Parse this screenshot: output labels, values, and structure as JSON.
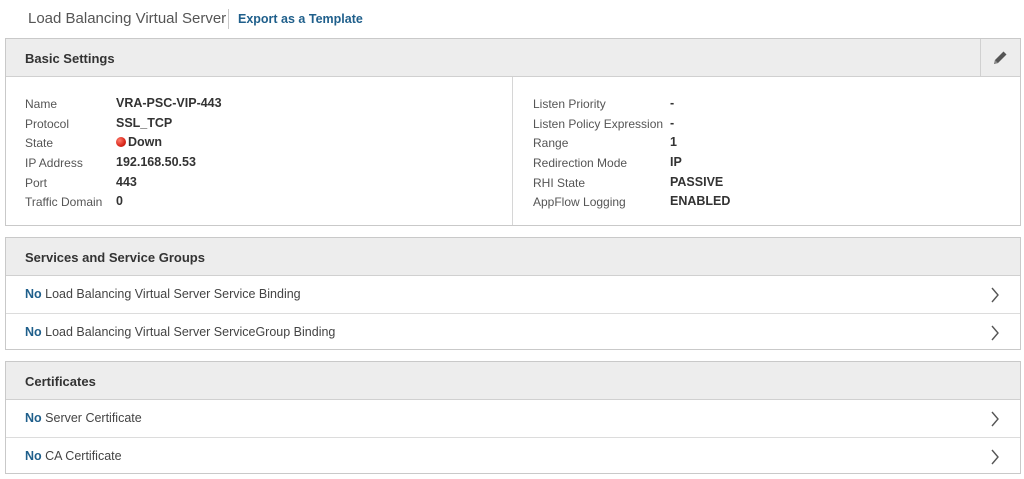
{
  "header": {
    "title": "Load Balancing Virtual Server",
    "export_link": "Export as a Template"
  },
  "basic_settings": {
    "title": "Basic Settings",
    "edit_icon": "pencil-icon",
    "left": [
      {
        "key": "Name",
        "value": "VRA-PSC-VIP-443"
      },
      {
        "key": "Protocol",
        "value": "SSL_TCP"
      },
      {
        "key": "State",
        "value": "Down",
        "status_color": "#d8261a"
      },
      {
        "key": "IP Address",
        "value": "192.168.50.53"
      },
      {
        "key": "Port",
        "value": "443"
      },
      {
        "key": "Traffic Domain",
        "value": "0"
      }
    ],
    "right": [
      {
        "key": "Listen Priority",
        "value": "-"
      },
      {
        "key": "Listen Policy Expression",
        "value": "-"
      },
      {
        "key": "Range",
        "value": "1"
      },
      {
        "key": "Redirection Mode",
        "value": "IP"
      },
      {
        "key": "RHI State",
        "value": "PASSIVE"
      },
      {
        "key": "AppFlow Logging",
        "value": "ENABLED"
      }
    ]
  },
  "services": {
    "title": "Services and Service Groups",
    "rows": [
      {
        "prefix": "No",
        "label": "Load Balancing Virtual Server Service Binding"
      },
      {
        "prefix": "No",
        "label": "Load Balancing Virtual Server ServiceGroup Binding"
      }
    ]
  },
  "certificates": {
    "title": "Certificates",
    "rows": [
      {
        "prefix": "No",
        "label": "Server Certificate"
      },
      {
        "prefix": "No",
        "label": "CA Certificate"
      }
    ]
  },
  "colors": {
    "link": "#1f5f8b",
    "panel_header": "#ededed",
    "status_down": "#d8261a"
  }
}
